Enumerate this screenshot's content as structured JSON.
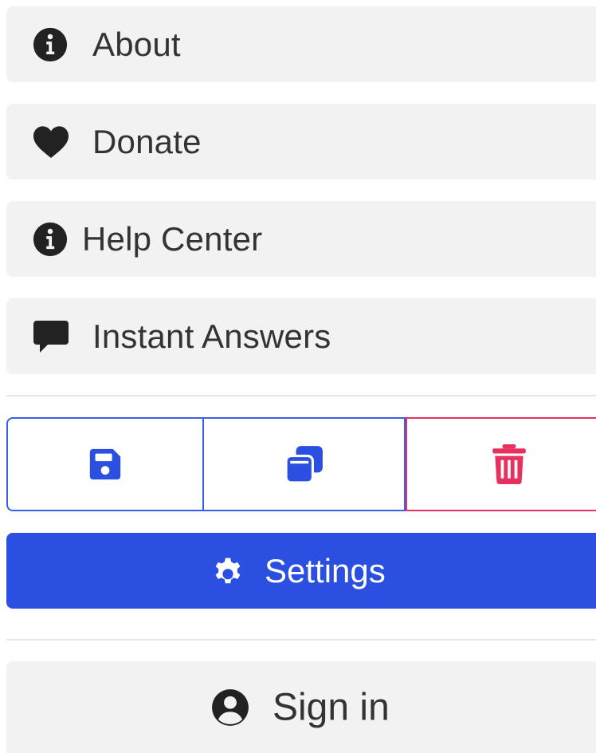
{
  "menu": {
    "items": [
      {
        "label": "About",
        "icon": "info-circle-icon"
      },
      {
        "label": "Donate",
        "icon": "heart-icon"
      },
      {
        "label": "Help Center",
        "icon": "info-circle-icon"
      },
      {
        "label": "Instant Answers",
        "icon": "comment-icon"
      }
    ]
  },
  "actions": {
    "save_icon": "floppy-disk-icon",
    "copy_icon": "copy-icon",
    "delete_icon": "trash-icon"
  },
  "settings": {
    "label": "Settings",
    "icon": "gear-icon"
  },
  "signin": {
    "label": "Sign in",
    "icon": "user-circle-icon"
  },
  "colors": {
    "primary": "#2b4fe0",
    "outline_primary": "#3a5ee8",
    "danger": "#e8305e",
    "item_bg": "#f2f2f2",
    "text": "#333333"
  }
}
